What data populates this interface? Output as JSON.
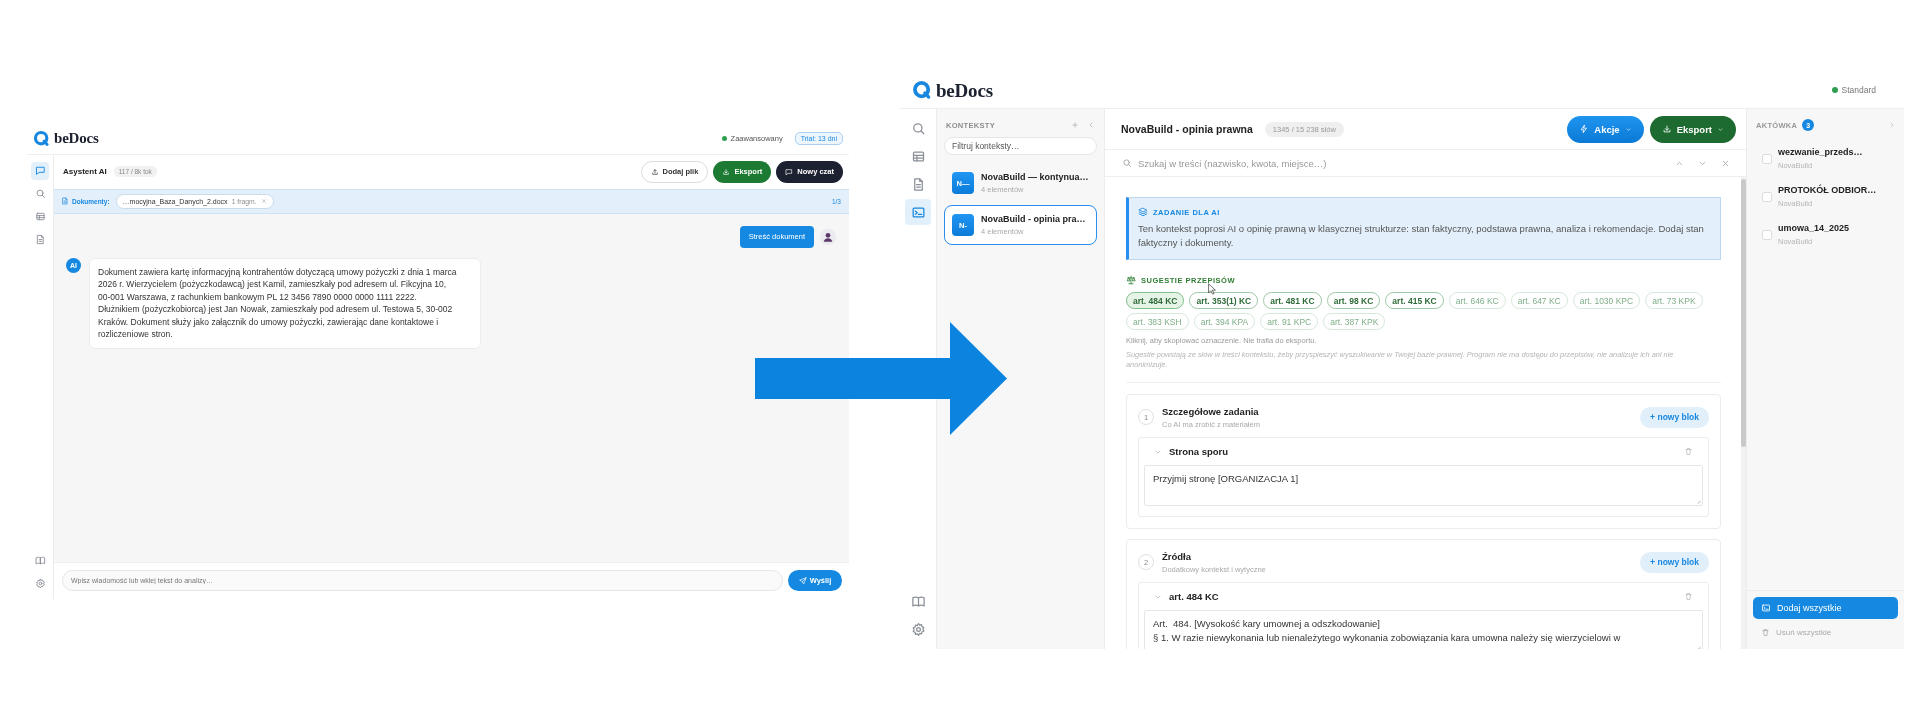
{
  "left_app": {
    "header": {
      "logo": "beDocs",
      "plan": "Zaawansowany",
      "trial": "Trial: 13 dni"
    },
    "rail": {
      "top": [
        {
          "kind": "chat",
          "selected": true
        },
        {
          "kind": "search",
          "selected": false
        },
        {
          "kind": "table",
          "selected": false
        },
        {
          "kind": "document",
          "selected": false
        }
      ],
      "bottom": [
        {
          "kind": "book",
          "selected": false
        },
        {
          "kind": "settings",
          "selected": false
        }
      ]
    },
    "toolbar": {
      "title": "Asystent AI",
      "tokens": "117 / 8k tok",
      "buttons": [
        {
          "label": "Dodaj plik",
          "kind": "upload"
        },
        {
          "label": "Eksport",
          "kind": "export"
        },
        {
          "label": "Nowy czat",
          "kind": "new_chat"
        }
      ]
    },
    "documents_bar": {
      "label": "Dokumenty:",
      "files": [
        {
          "name": "…mocyjna_Baza_Danych_2.docx",
          "fragments": "1 fragm."
        }
      ],
      "counter": "1/3"
    },
    "messages": [
      {
        "kind": "user",
        "text": "Streść dokument"
      },
      {
        "kind": "ai",
        "avatar": "AI",
        "text": "Dokument zawiera kartę informacyjną kontrahentów dotyczącą umowy pożyczki z dnia 1 marca 2026 r. Wierzycielem (pożyczkodawcą) jest Kamil, zamieszkały pod adresem ul. Fikcyjna 10, 00-001 Warszawa, z rachunkiem bankowym PL 12 3456 7890 0000 0000 1111 2222. Dłużnikiem (pożyczkobiorcą) jest Jan Nowak, zamieszkały pod adresem ul. Testowa 5, 30-002 Kraków. Dokument służy jako załącznik do umowy pożyczki, zawierając dane kontaktowe i rozliczeniowe stron."
      }
    ],
    "composer": {
      "placeholder": "Wpisz wiadomość lub wklej tekst do analizy…",
      "send": "Wyślij"
    }
  },
  "right_app": {
    "header": {
      "logo": "beDocs",
      "plan": "Standard"
    },
    "rail": {
      "top": [
        {
          "kind": "search",
          "selected": false
        },
        {
          "kind": "table",
          "selected": false
        },
        {
          "kind": "document",
          "selected": false
        },
        {
          "kind": "terminal",
          "selected": true
        }
      ],
      "bottom": [
        {
          "kind": "book",
          "selected": false
        },
        {
          "kind": "settings",
          "selected": false
        }
      ]
    },
    "contexts": {
      "heading": "KONTEKSTY",
      "filter_placeholder": "Filtruj konteksty…",
      "items": [
        {
          "badge": "N—",
          "title": "NovaBuild — kontynua…",
          "count": "4 elementów",
          "selected": false
        },
        {
          "badge": "N-",
          "title": "NovaBuild - opinia pra…",
          "count": "4 elementów",
          "selected": true
        }
      ]
    },
    "editor": {
      "title": "NovaBuild - opinia prawna",
      "word_count": "1345 / 15 238 słów",
      "buttons": [
        {
          "label": "Akcje",
          "kind": "actions"
        },
        {
          "label": "Eksport",
          "kind": "export"
        }
      ],
      "search_placeholder": "Szukaj w treści (nazwisko, kwota, miejsce…)",
      "task": {
        "heading": "ZADANIE DLA AI",
        "text": "Ten kontekst poprosi AI o opinię prawną w klasycznej strukturze: stan faktyczny, podstawa prawna, analiza i rekomendacje. Dodaj stan faktyczny i dokumenty."
      },
      "suggestions": {
        "heading": "SUGESTIE PRZEPISÓW",
        "rows": [
          [
            {
              "label": "art. 484 KC",
              "kind": "strong",
              "selected": true
            },
            {
              "label": "art. 353(1) KC",
              "kind": "strong",
              "selected": false
            },
            {
              "label": "art. 481 KC",
              "kind": "strong",
              "selected": false
            },
            {
              "label": "art. 98 KC",
              "kind": "strong",
              "selected": false
            },
            {
              "label": "art. 415 KC",
              "kind": "strong",
              "selected": false
            },
            {
              "label": "art. 646 KC",
              "kind": "weak",
              "selected": false
            },
            {
              "label": "art. 647 KC",
              "kind": "weak",
              "selected": false
            },
            {
              "label": "art. 1030 KPC",
              "kind": "weak",
              "selected": false
            },
            {
              "label": "art. 73 KPK",
              "kind": "weak",
              "selected": false
            }
          ],
          [
            {
              "label": "art. 383 KSH",
              "kind": "weak",
              "selected": false
            },
            {
              "label": "art. 394 KPA",
              "kind": "weak",
              "selected": false
            },
            {
              "label": "art. 91 KPC",
              "kind": "weak",
              "selected": false
            },
            {
              "label": "art. 387 KPK",
              "kind": "weak",
              "selected": false
            }
          ]
        ],
        "hint": "Kliknij, aby skopiować oznaczenie. Nie trafia do eksportu.",
        "note": "Sugestie powstają ze słów w treści kontekstu, żeby przyspieszyć wyszukiwanie w Twojej bazie prawnej. Program nie ma dostępu do przepisów, nie analizuje ich ani nie anonimizuje."
      },
      "sections": [
        {
          "number": "1",
          "title": "Szczegółowe zadania",
          "subtitle": "Co AI ma zrobić z materiałem",
          "add_button": "+ nowy blok",
          "blocks": [
            {
              "title": "Strona sporu",
              "expanded": true,
              "text": "Przyjmij stronę [ORGANIZACJA 1]"
            }
          ]
        },
        {
          "number": "2",
          "title": "Źródła",
          "subtitle": "Dodatkowy kontekst i wytyczne",
          "add_button": "+ nowy blok",
          "blocks": [
            {
              "title": "art. 484 KC",
              "expanded": true,
              "text": "Art.  484. [Wysokość kary umownej a odszkodowanie]\n§ 1. W razie niewykonania lub nienależytego wykonania zobowiązania kara umowna należy się wierzycielowi w"
            }
          ]
        }
      ]
    },
    "briefcase": {
      "heading": "AKTÓWKA",
      "count": "3",
      "items": [
        {
          "title": "wezwanie_przeds…",
          "source": "NovaBuild",
          "checked": false
        },
        {
          "title": "PROTOKÓŁ ODBIOR…",
          "source": "NovaBuild",
          "checked": false
        },
        {
          "title": "umowa_14_2025",
          "source": "NovaBuild",
          "checked": false
        }
      ],
      "add_all": "Dodaj wszystkie",
      "remove_all": "Usuń wszystkie"
    }
  }
}
